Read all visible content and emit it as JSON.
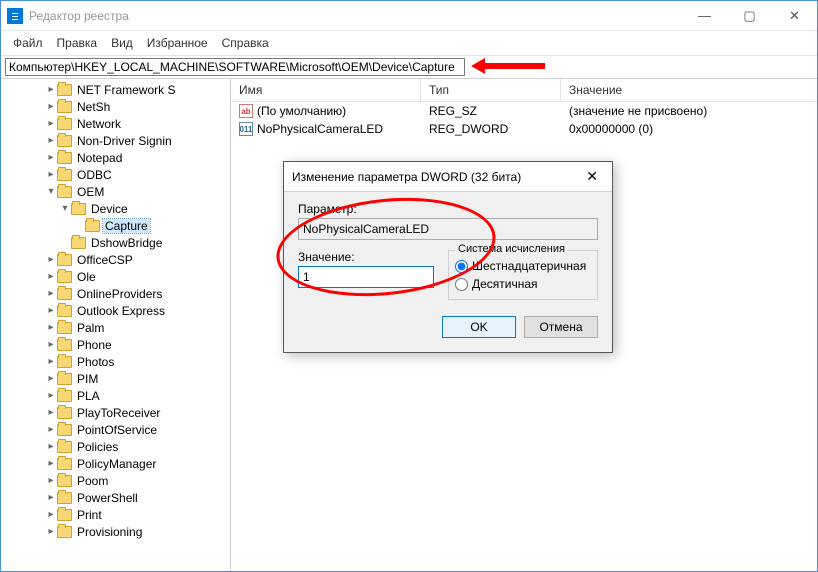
{
  "window": {
    "title": "Редактор реестра"
  },
  "menu": {
    "file": "Файл",
    "edit": "Правка",
    "view": "Вид",
    "favorites": "Избранное",
    "help": "Справка"
  },
  "addressbar": {
    "value": "Компьютер\\HKEY_LOCAL_MACHINE\\SOFTWARE\\Microsoft\\OEM\\Device\\Capture"
  },
  "tree": {
    "items": [
      {
        "depth": 3,
        "caret": "▸",
        "label": "NET Framework S"
      },
      {
        "depth": 3,
        "caret": "▸",
        "label": "NetSh"
      },
      {
        "depth": 3,
        "caret": "▸",
        "label": "Network"
      },
      {
        "depth": 3,
        "caret": "▸",
        "label": "Non-Driver Signin"
      },
      {
        "depth": 3,
        "caret": "▸",
        "label": "Notepad"
      },
      {
        "depth": 3,
        "caret": "▸",
        "label": "ODBC"
      },
      {
        "depth": 3,
        "caret": "▾",
        "label": "OEM"
      },
      {
        "depth": 4,
        "caret": "▾",
        "label": "Device"
      },
      {
        "depth": 5,
        "caret": "",
        "label": "Capture",
        "selected": true
      },
      {
        "depth": 4,
        "caret": "",
        "label": "DshowBridge"
      },
      {
        "depth": 3,
        "caret": "▸",
        "label": "OfficeCSP"
      },
      {
        "depth": 3,
        "caret": "▸",
        "label": "Ole"
      },
      {
        "depth": 3,
        "caret": "▸",
        "label": "OnlineProviders"
      },
      {
        "depth": 3,
        "caret": "▸",
        "label": "Outlook Express"
      },
      {
        "depth": 3,
        "caret": "▸",
        "label": "Palm"
      },
      {
        "depth": 3,
        "caret": "▸",
        "label": "Phone"
      },
      {
        "depth": 3,
        "caret": "▸",
        "label": "Photos"
      },
      {
        "depth": 3,
        "caret": "▸",
        "label": "PIM"
      },
      {
        "depth": 3,
        "caret": "▸",
        "label": "PLA"
      },
      {
        "depth": 3,
        "caret": "▸",
        "label": "PlayToReceiver"
      },
      {
        "depth": 3,
        "caret": "▸",
        "label": "PointOfService"
      },
      {
        "depth": 3,
        "caret": "▸",
        "label": "Policies"
      },
      {
        "depth": 3,
        "caret": "▸",
        "label": "PolicyManager"
      },
      {
        "depth": 3,
        "caret": "▸",
        "label": "Poom"
      },
      {
        "depth": 3,
        "caret": "▸",
        "label": "PowerShell"
      },
      {
        "depth": 3,
        "caret": "▸",
        "label": "Print"
      },
      {
        "depth": 3,
        "caret": "▸",
        "label": "Provisioning"
      }
    ]
  },
  "list": {
    "headers": {
      "name": "Имя",
      "type": "Тип",
      "value": "Значение"
    },
    "rows": [
      {
        "icon": "str",
        "name": "(По умолчанию)",
        "type": "REG_SZ",
        "value": "(значение не присвоено)"
      },
      {
        "icon": "dw",
        "name": "NoPhysicalCameraLED",
        "type": "REG_DWORD",
        "value": "0x00000000 (0)"
      }
    ]
  },
  "dialog": {
    "title": "Изменение параметра DWORD (32 бита)",
    "param_label": "Параметр:",
    "param_value": "NoPhysicalCameraLED",
    "value_label": "Значение:",
    "value_value": "1",
    "base_legend": "Система исчисления",
    "base_hex": "Шестнадцатеричная",
    "base_dec": "Десятичная",
    "ok": "OK",
    "cancel": "Отмена"
  }
}
